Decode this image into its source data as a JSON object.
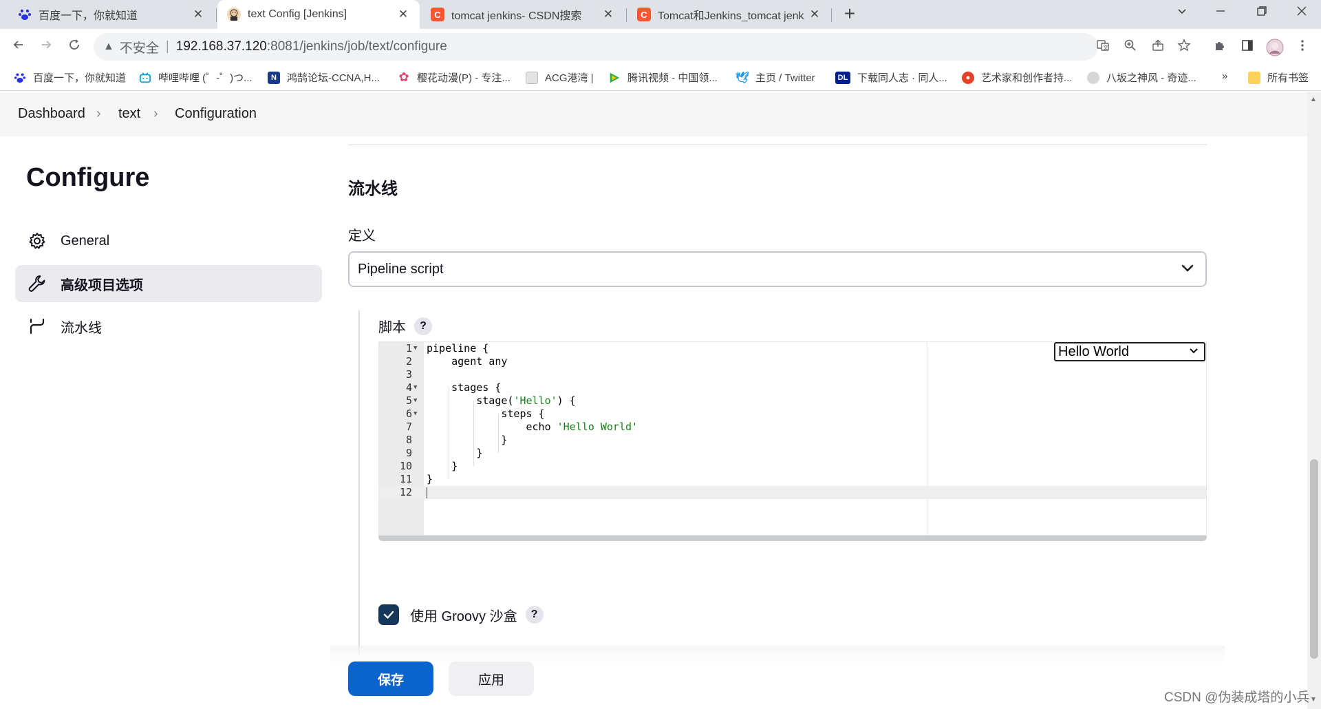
{
  "browser": {
    "tabs": [
      {
        "title": "百度一下，你就知道",
        "icon": "baidu-paw-icon",
        "color": "#2932e1"
      },
      {
        "title": "text Config [Jenkins]",
        "icon": "jenkins-icon",
        "color": "#d33833",
        "active": true
      },
      {
        "title": "tomcat jenkins- CSDN搜索",
        "icon": "csdn-icon",
        "color": "#fc5531"
      },
      {
        "title": "Tomcat和Jenkins_tomcat jenk",
        "icon": "csdn-icon",
        "color": "#fc5531"
      }
    ],
    "address": {
      "insecure_label": "不安全",
      "host": "192.168.37.120",
      "path": ":8081/jenkins/job/text/configure"
    },
    "bookmarks": [
      {
        "label": "百度一下，你就知道",
        "icon": "baidu-paw-icon",
        "color": "#2932e1"
      },
      {
        "label": "哔哩哔哩 (゜-゜)つ...",
        "icon": "bilibili-icon",
        "color": "#00a1d6"
      },
      {
        "label": "鸿鹄论坛-CCNA,H...",
        "icon": "hh-forum-icon",
        "color": "#1b3a8a"
      },
      {
        "label": "樱花动漫(P) - 专注...",
        "icon": "sakura-icon",
        "color": "#e0457b"
      },
      {
        "label": "ACG港湾 |",
        "icon": "acg-icon",
        "color": "#bdbdbd"
      },
      {
        "label": "腾讯视频 - 中国领...",
        "icon": "tencent-video-icon",
        "color": "#22b14c"
      },
      {
        "label": "主页 / Twitter",
        "icon": "twitter-icon",
        "color": "#1d9bf0"
      },
      {
        "label": "下载同人志 · 同人...",
        "icon": "dl-icon",
        "color": "#001f8a"
      },
      {
        "label": "艺术家和创作者持...",
        "icon": "patreon-icon",
        "color": "#e8412a"
      },
      {
        "label": "八坂之神风 - 奇迹...",
        "icon": "yasaka-icon",
        "color": "#9aa0a6"
      }
    ],
    "bookmarks_more": "»",
    "all_bookmarks": "所有书签"
  },
  "breadcrumb": {
    "items": [
      "Dashboard",
      "text",
      "Configuration"
    ]
  },
  "sidebar": {
    "title": "Configure",
    "items": [
      {
        "label": "General",
        "icon": "gear-icon"
      },
      {
        "label": "高级项目选项",
        "icon": "wrench-icon",
        "active": true
      },
      {
        "label": "流水线",
        "icon": "pipeline-icon"
      }
    ]
  },
  "pipeline": {
    "section_title": "流水线",
    "definition_label": "定义",
    "definition_value": "Pipeline script",
    "script_label": "脚本",
    "help": "?",
    "sample_select": "Hello World",
    "code": [
      {
        "n": "1",
        "fold": true,
        "pre": "pipeline {",
        "str": "",
        "post": ""
      },
      {
        "n": "2",
        "fold": false,
        "pre": "    agent any",
        "str": "",
        "post": ""
      },
      {
        "n": "3",
        "fold": false,
        "pre": "",
        "str": "",
        "post": ""
      },
      {
        "n": "4",
        "fold": true,
        "pre": "    stages {",
        "str": "",
        "post": ""
      },
      {
        "n": "5",
        "fold": true,
        "pre": "        stage(",
        "str": "'Hello'",
        "post": ") {"
      },
      {
        "n": "6",
        "fold": true,
        "pre": "            steps {",
        "str": "",
        "post": ""
      },
      {
        "n": "7",
        "fold": false,
        "pre": "                echo ",
        "str": "'Hello World'",
        "post": ""
      },
      {
        "n": "8",
        "fold": false,
        "pre": "            }",
        "str": "",
        "post": ""
      },
      {
        "n": "9",
        "fold": false,
        "pre": "        }",
        "str": "",
        "post": ""
      },
      {
        "n": "10",
        "fold": false,
        "pre": "    }",
        "str": "",
        "post": ""
      },
      {
        "n": "11",
        "fold": false,
        "pre": "}",
        "str": "",
        "post": ""
      },
      {
        "n": "12",
        "fold": false,
        "pre": "",
        "str": "",
        "post": "",
        "active": true
      }
    ],
    "sandbox_label": "使用 Groovy 沙盒",
    "sandbox_checked": true
  },
  "buttons": {
    "save": "保存",
    "apply": "应用"
  },
  "watermark": "CSDN @伪装成塔的小兵"
}
